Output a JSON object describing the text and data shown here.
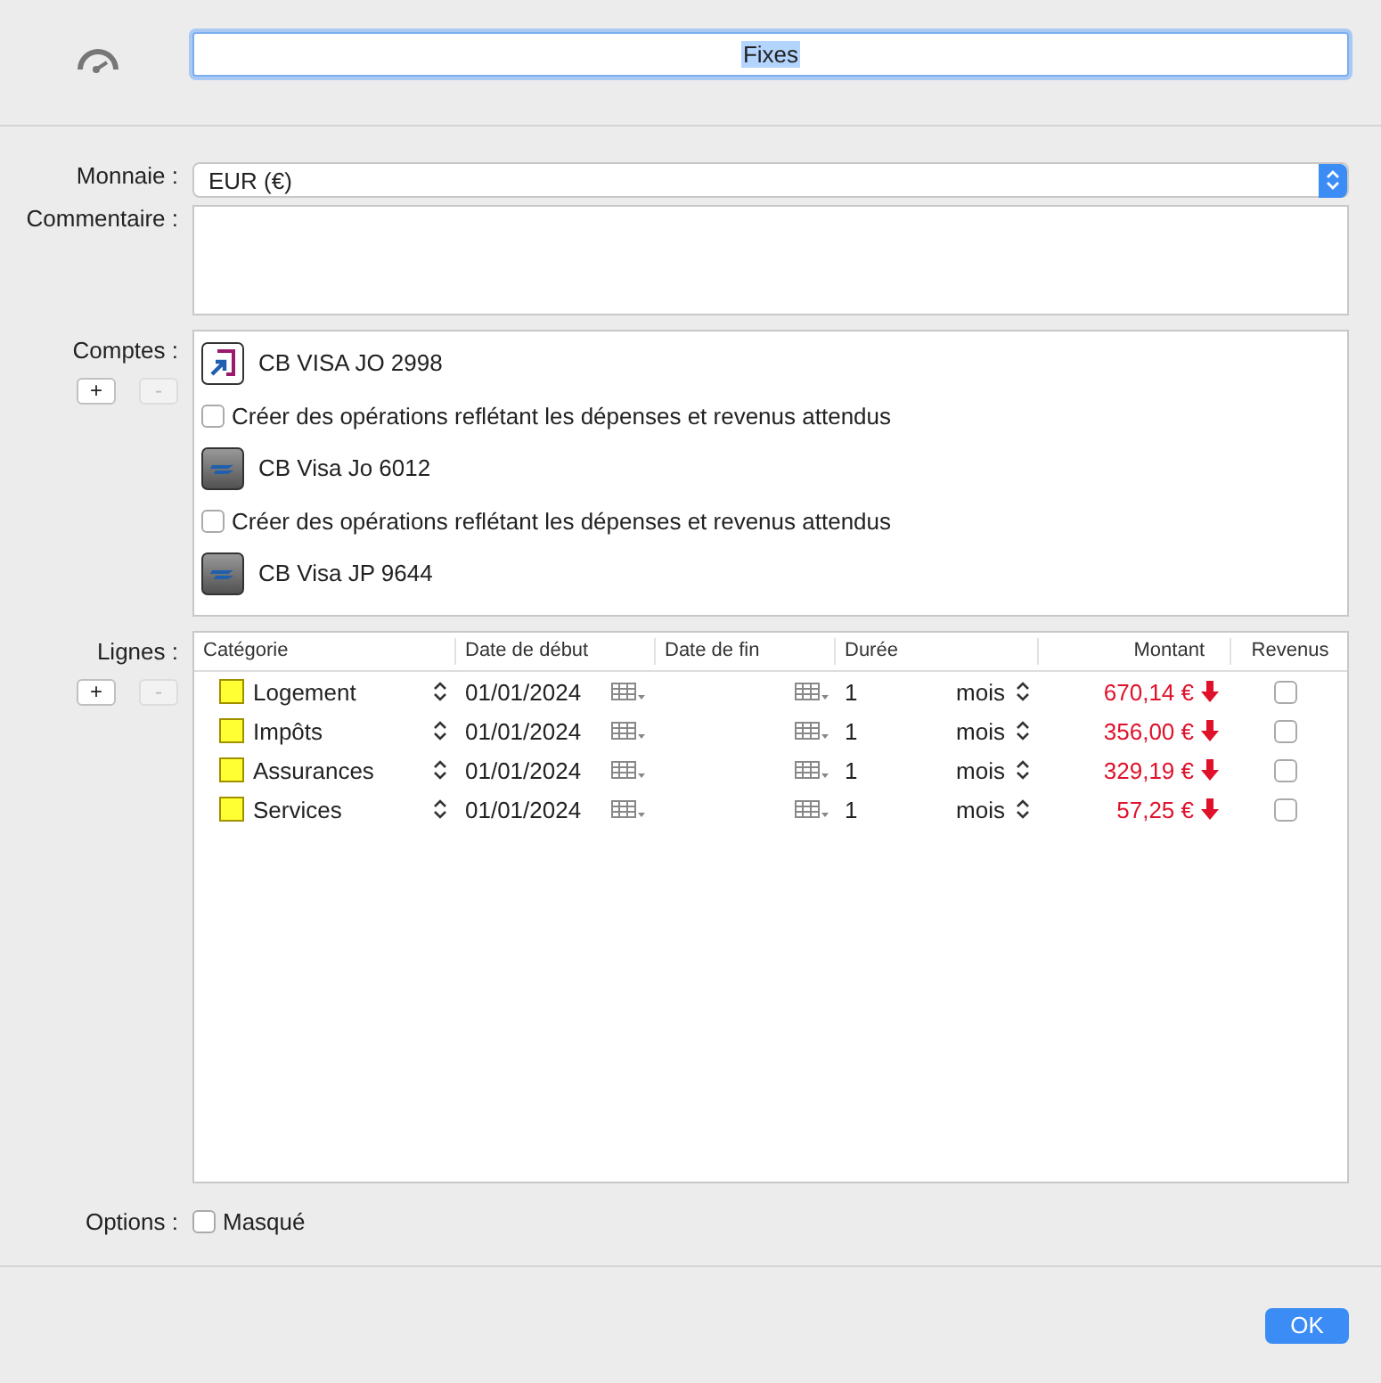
{
  "header": {
    "name": "Fixes",
    "name_selected": true
  },
  "currency": {
    "label": "Monnaie :",
    "value": "EUR (€)"
  },
  "comment": {
    "label": "Commentaire :"
  },
  "accounts": {
    "label": "Comptes :",
    "add": {
      "label": "+",
      "disabled": false
    },
    "remove": {
      "label": "-",
      "disabled": true
    },
    "items": [
      {
        "name": "CB VISA JO 2998",
        "kind": "card",
        "option": {
          "label": "Créer des opérations reflétant les dépenses et revenus attendus",
          "checked": false
        }
      },
      {
        "name": "CB Visa Jo 6012",
        "kind": "bank",
        "option": {
          "label": "Créer des opérations reflétant les dépenses et revenus attendus",
          "checked": false
        }
      },
      {
        "name": "CB Visa JP 9644",
        "kind": "bank"
      }
    ]
  },
  "lines": {
    "label": "Lignes :",
    "add": {
      "label": "+",
      "disabled": false
    },
    "remove": {
      "label": "-",
      "disabled": true
    },
    "columns": [
      "Catégorie",
      "Date de début",
      "Date de fin",
      "Durée",
      "Montant",
      "Revenus"
    ],
    "rows": [
      {
        "category": "Logement",
        "color": "#ffff33",
        "start": "01/01/2024",
        "duration": "1",
        "unit": "mois",
        "amount": "670,14 €",
        "kind": "expense",
        "income": false
      },
      {
        "category": "Impôts",
        "color": "#ffff33",
        "start": "01/01/2024",
        "duration": "1",
        "unit": "mois",
        "amount": "356,00 €",
        "kind": "expense",
        "income": false
      },
      {
        "category": "Assurances",
        "color": "#ffff33",
        "start": "01/01/2024",
        "duration": "1",
        "unit": "mois",
        "amount": "329,19 €",
        "kind": "expense",
        "income": false
      },
      {
        "category": "Services",
        "color": "#ffff33",
        "start": "01/01/2024",
        "duration": "1",
        "unit": "mois",
        "amount": "57,25 €",
        "kind": "expense",
        "income": false
      }
    ]
  },
  "options": {
    "label": "Options :",
    "hidden": {
      "label": "Masqué",
      "checked": false
    }
  },
  "ok": "OK"
}
